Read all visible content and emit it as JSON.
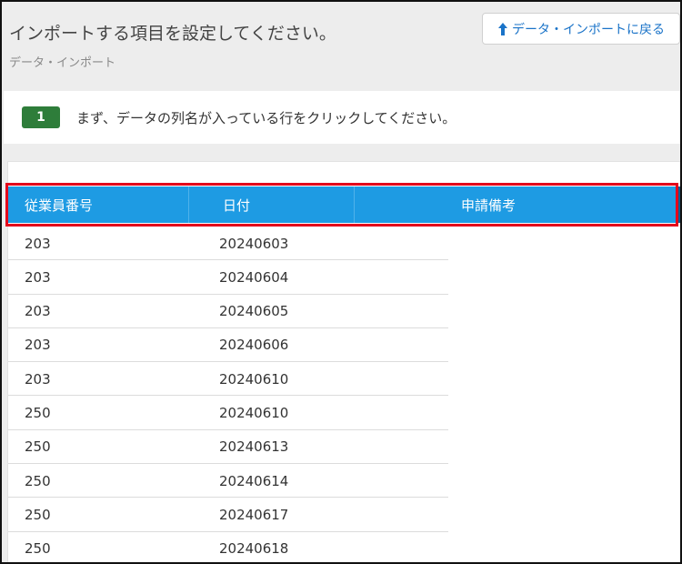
{
  "header": {
    "title": "インポートする項目を設定してください。",
    "breadcrumb": "データ・インポート",
    "back_button_label": "データ・インポートに戻る",
    "back_button_icon": "arrow-up-icon"
  },
  "instruction": {
    "step_number": "1",
    "text": "まず、データの列名が入っている行をクリックしてください。"
  },
  "table": {
    "columns": [
      "従業員番号",
      "日付",
      "申請備考"
    ],
    "rows": [
      [
        "203",
        "20240603"
      ],
      [
        "203",
        "20240604"
      ],
      [
        "203",
        "20240605"
      ],
      [
        "203",
        "20240606"
      ],
      [
        "203",
        "20240610"
      ],
      [
        "250",
        "20240610"
      ],
      [
        "250",
        "20240613"
      ],
      [
        "250",
        "20240614"
      ],
      [
        "250",
        "20240617"
      ],
      [
        "250",
        "20240618"
      ]
    ]
  },
  "colors": {
    "header_row": "#1e9be3",
    "highlight": "#e3001b",
    "step_badge": "#2e7d3a",
    "link": "#1a73c8"
  }
}
